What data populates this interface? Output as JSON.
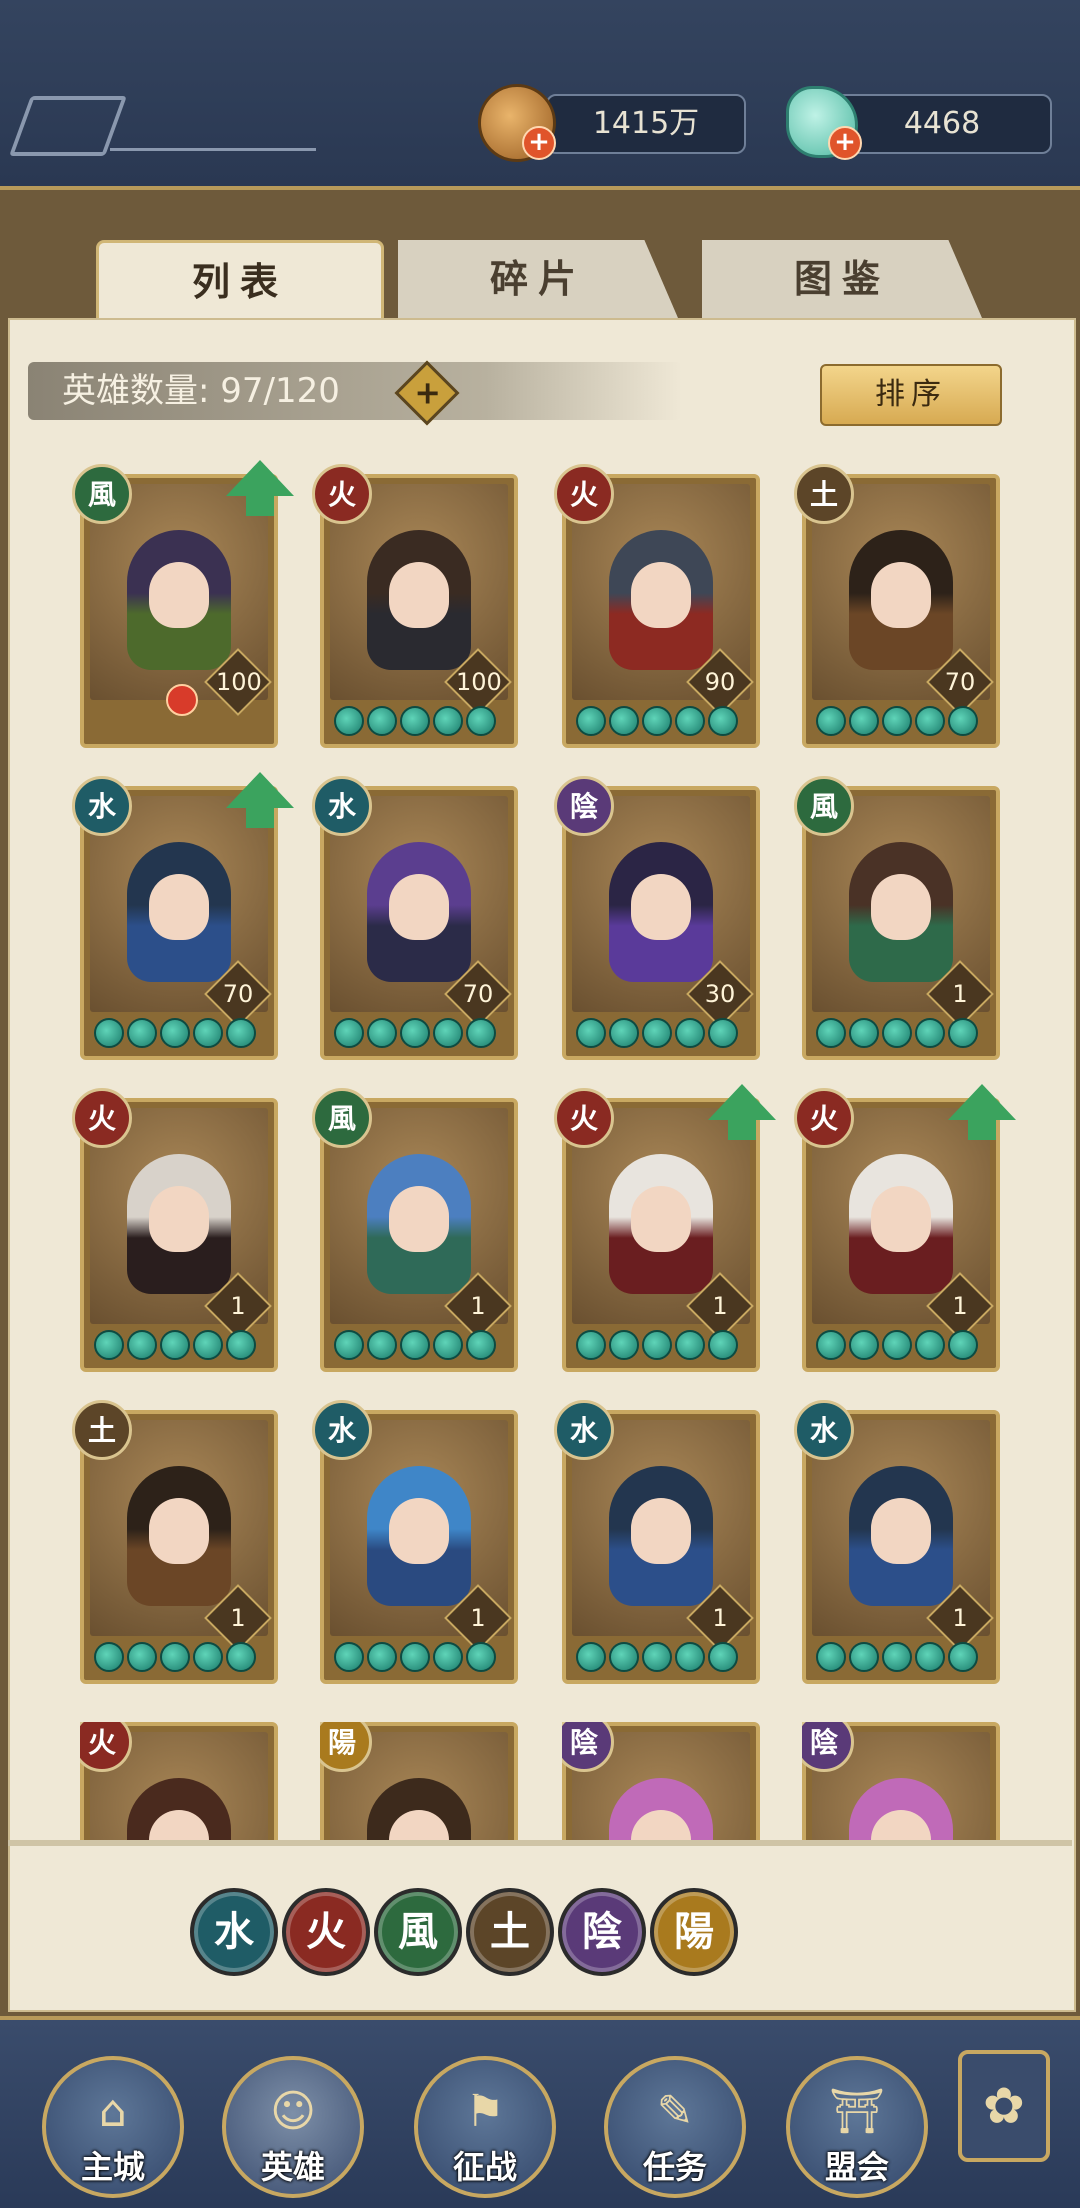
{
  "resources": {
    "coins": "1415万",
    "jade": "4468"
  },
  "tabs": [
    "列表",
    "碎片",
    "图鉴"
  ],
  "hero_count_label": "英雄数量: 97/120",
  "sort_label": "排序",
  "colors": {
    "water": "#1f5c66",
    "fire": "#8a2a22",
    "wind": "#2d6a3e",
    "earth": "#5c4528",
    "yin": "#5a3a78",
    "yang": "#a97a1e"
  },
  "heroes": [
    {
      "elem": "wind",
      "glyph": "風",
      "level": "100",
      "stars": 0,
      "up": true,
      "mark": true,
      "hair": "#3b3152",
      "outfit": "#4d6a2c"
    },
    {
      "elem": "fire",
      "glyph": "火",
      "level": "100",
      "stars": 5,
      "up": false,
      "mark": false,
      "hair": "#3a2b22",
      "outfit": "#2a2a30"
    },
    {
      "elem": "fire",
      "glyph": "火",
      "level": "90",
      "stars": 5,
      "up": false,
      "mark": false,
      "hair": "#3e4756",
      "outfit": "#8d2a22"
    },
    {
      "elem": "earth",
      "glyph": "土",
      "level": "70",
      "stars": 5,
      "up": false,
      "mark": false,
      "hair": "#2d2219",
      "outfit": "#6b4626"
    },
    {
      "elem": "water",
      "glyph": "水",
      "level": "70",
      "stars": 5,
      "up": true,
      "mark": false,
      "hair": "#23364f",
      "outfit": "#2c4f8a"
    },
    {
      "elem": "water",
      "glyph": "水",
      "level": "70",
      "stars": 5,
      "up": false,
      "mark": false,
      "hair": "#5b3e8f",
      "outfit": "#2b2b48"
    },
    {
      "elem": "yin",
      "glyph": "陰",
      "level": "30",
      "stars": 5,
      "up": false,
      "mark": false,
      "hair": "#2b2545",
      "outfit": "#5a3a9a"
    },
    {
      "elem": "wind",
      "glyph": "風",
      "level": "1",
      "stars": 5,
      "up": false,
      "mark": false,
      "hair": "#4a3226",
      "outfit": "#2e6a4a"
    },
    {
      "elem": "fire",
      "glyph": "火",
      "level": "1",
      "stars": 5,
      "up": false,
      "mark": false,
      "hair": "#d8d2ca",
      "outfit": "#2a1e1e"
    },
    {
      "elem": "wind",
      "glyph": "風",
      "level": "1",
      "stars": 5,
      "up": false,
      "mark": false,
      "hair": "#4c7fc0",
      "outfit": "#2f6a58"
    },
    {
      "elem": "fire",
      "glyph": "火",
      "level": "1",
      "stars": 5,
      "up": true,
      "mark": false,
      "hair": "#e8e4de",
      "outfit": "#6a1e20"
    },
    {
      "elem": "fire",
      "glyph": "火",
      "level": "1",
      "stars": 5,
      "up": true,
      "mark": false,
      "hair": "#e8e4de",
      "outfit": "#6a1e20"
    },
    {
      "elem": "earth",
      "glyph": "土",
      "level": "1",
      "stars": 5,
      "up": false,
      "mark": false,
      "hair": "#2d2219",
      "outfit": "#6b4626"
    },
    {
      "elem": "water",
      "glyph": "水",
      "level": "1",
      "stars": 5,
      "up": false,
      "mark": false,
      "hair": "#3f86c8",
      "outfit": "#2a4a80"
    },
    {
      "elem": "water",
      "glyph": "水",
      "level": "1",
      "stars": 5,
      "up": false,
      "mark": false,
      "hair": "#23364f",
      "outfit": "#2c4f8a"
    },
    {
      "elem": "water",
      "glyph": "水",
      "level": "1",
      "stars": 5,
      "up": false,
      "mark": false,
      "hair": "#23364f",
      "outfit": "#2c4f8a"
    },
    {
      "elem": "fire",
      "glyph": "火",
      "level": "",
      "stars": 0,
      "up": false,
      "mark": false,
      "hair": "#4a2a1e",
      "outfit": "#2a2a2a"
    },
    {
      "elem": "yang",
      "glyph": "陽",
      "level": "",
      "stars": 0,
      "up": false,
      "mark": false,
      "hair": "#3d2a1c",
      "outfit": "#2a2a2a"
    },
    {
      "elem": "yin",
      "glyph": "陰",
      "level": "",
      "stars": 0,
      "up": false,
      "mark": false,
      "hair": "#c06ab8",
      "outfit": "#3a2a5a"
    },
    {
      "elem": "yin",
      "glyph": "陰",
      "level": "",
      "stars": 0,
      "up": false,
      "mark": false,
      "hair": "#c06ab8",
      "outfit": "#3a2a5a"
    }
  ],
  "filters": [
    {
      "elem": "water",
      "glyph": "水"
    },
    {
      "elem": "fire",
      "glyph": "火"
    },
    {
      "elem": "wind",
      "glyph": "風"
    },
    {
      "elem": "earth",
      "glyph": "土"
    },
    {
      "elem": "yin",
      "glyph": "陰"
    },
    {
      "elem": "yang",
      "glyph": "陽"
    }
  ],
  "nav": [
    {
      "label": "主城",
      "icon": "city-icon",
      "glyph": "⌂"
    },
    {
      "label": "英雄",
      "icon": "hero-icon",
      "glyph": "☺"
    },
    {
      "label": "征战",
      "icon": "battle-icon",
      "glyph": "⚑"
    },
    {
      "label": "任务",
      "icon": "quest-icon",
      "glyph": "✎"
    },
    {
      "label": "盟会",
      "icon": "guild-icon",
      "glyph": "⛩"
    }
  ],
  "menu_glyph": "✿"
}
